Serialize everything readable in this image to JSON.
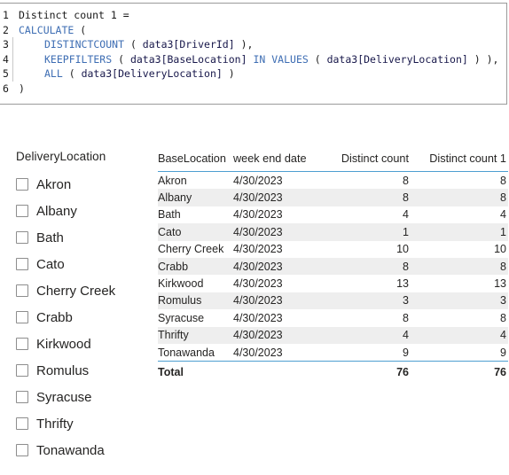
{
  "formula_editor": {
    "name": "dax-formula-editor",
    "lines": [
      {
        "number": "1",
        "indent": 0,
        "guide": false,
        "tokens": [
          {
            "t": "Distinct count 1 =",
            "c": "pl"
          }
        ]
      },
      {
        "number": "2",
        "indent": 0,
        "guide": false,
        "tokens": [
          {
            "t": "CALCULATE",
            "c": "kw"
          },
          {
            "t": " (",
            "c": "pl"
          }
        ]
      },
      {
        "number": "3",
        "indent": 1,
        "guide": true,
        "tokens": [
          {
            "t": "DISTINCTCOUNT",
            "c": "kw"
          },
          {
            "t": " ( ",
            "c": "pl"
          },
          {
            "t": "data3[DriverId]",
            "c": "ref"
          },
          {
            "t": " ),",
            "c": "pl"
          }
        ]
      },
      {
        "number": "4",
        "indent": 1,
        "guide": true,
        "tokens": [
          {
            "t": "KEEPFILTERS",
            "c": "kw"
          },
          {
            "t": " ( ",
            "c": "pl"
          },
          {
            "t": "data3[BaseLocation]",
            "c": "ref"
          },
          {
            "t": " ",
            "c": "pl"
          },
          {
            "t": "IN",
            "c": "kw"
          },
          {
            "t": " ",
            "c": "pl"
          },
          {
            "t": "VALUES",
            "c": "kw"
          },
          {
            "t": " ( ",
            "c": "pl"
          },
          {
            "t": "data3[DeliveryLocation]",
            "c": "ref"
          },
          {
            "t": " ) ),",
            "c": "pl"
          }
        ]
      },
      {
        "number": "5",
        "indent": 1,
        "guide": true,
        "tokens": [
          {
            "t": "ALL",
            "c": "kw"
          },
          {
            "t": " ( ",
            "c": "pl"
          },
          {
            "t": "data3[DeliveryLocation]",
            "c": "ref"
          },
          {
            "t": " )",
            "c": "pl"
          }
        ]
      },
      {
        "number": "6",
        "indent": 0,
        "guide": false,
        "tokens": [
          {
            "t": ")",
            "c": "pl"
          }
        ]
      }
    ]
  },
  "slicer": {
    "title": "DeliveryLocation",
    "items": [
      {
        "label": "Akron",
        "checked": false
      },
      {
        "label": "Albany",
        "checked": false
      },
      {
        "label": "Bath",
        "checked": false
      },
      {
        "label": "Cato",
        "checked": false
      },
      {
        "label": "Cherry Creek",
        "checked": false
      },
      {
        "label": "Crabb",
        "checked": false
      },
      {
        "label": "Kirkwood",
        "checked": false
      },
      {
        "label": "Romulus",
        "checked": false
      },
      {
        "label": "Syracuse",
        "checked": false
      },
      {
        "label": "Thrifty",
        "checked": false
      },
      {
        "label": "Tonawanda",
        "checked": false
      }
    ]
  },
  "table": {
    "columns": [
      "BaseLocation",
      "week end date",
      "Distinct count",
      "Distinct count 1"
    ],
    "rows": [
      [
        "Akron",
        "4/30/2023",
        "8",
        "8"
      ],
      [
        "Albany",
        "4/30/2023",
        "8",
        "8"
      ],
      [
        "Bath",
        "4/30/2023",
        "4",
        "4"
      ],
      [
        "Cato",
        "4/30/2023",
        "1",
        "1"
      ],
      [
        "Cherry Creek",
        "4/30/2023",
        "10",
        "10"
      ],
      [
        "Crabb",
        "4/30/2023",
        "8",
        "8"
      ],
      [
        "Kirkwood",
        "4/30/2023",
        "13",
        "13"
      ],
      [
        "Romulus",
        "4/30/2023",
        "3",
        "3"
      ],
      [
        "Syracuse",
        "4/30/2023",
        "8",
        "8"
      ],
      [
        "Thrifty",
        "4/30/2023",
        "4",
        "4"
      ],
      [
        "Tonawanda",
        "4/30/2023",
        "9",
        "9"
      ]
    ],
    "total": [
      "Total",
      "",
      "76",
      "76"
    ]
  },
  "colors": {
    "accent": "#4e9fd1",
    "keyword": "#3d6db3",
    "reference": "#17174a",
    "band": "#eeeeee",
    "text": "#252423"
  }
}
